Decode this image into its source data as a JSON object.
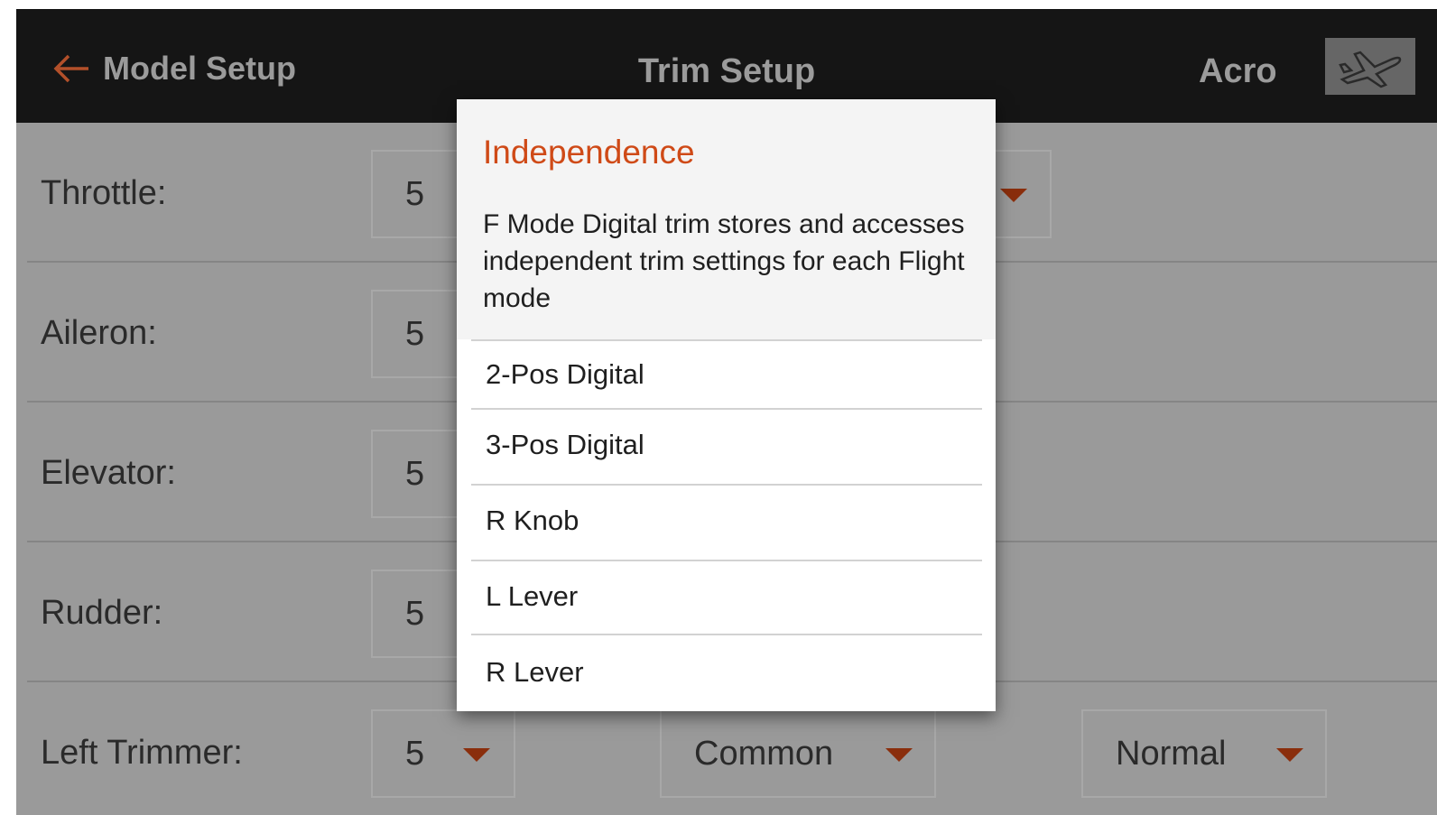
{
  "header": {
    "back_label": "Model Setup",
    "title": "Trim Setup",
    "mode": "Acro",
    "back_icon": "arrow-left-icon",
    "model_icon": "airplane-icon"
  },
  "rows": [
    {
      "label": "Throttle:",
      "value": "5"
    },
    {
      "label": "Aileron:",
      "value": "5"
    },
    {
      "label": "Elevator:",
      "value": "5"
    },
    {
      "label": "Rudder:",
      "value": "5"
    },
    {
      "label": "Left Trimmer:",
      "value": "5",
      "type": "Common",
      "mode": "Normal"
    }
  ],
  "popup": {
    "title": "Independence",
    "description": "F Mode Digital trim stores and accesses independent trim settings for each Flight mode",
    "options": [
      "2-Pos Digital",
      "3-Pos Digital",
      "R Knob",
      "L Lever",
      "R Lever"
    ]
  },
  "colors": {
    "header_bg": "#151515",
    "dimmed_bg": "#9a9a9a",
    "accent": "#cf4a17",
    "dropdown_arrow": "#8a2e0c"
  }
}
